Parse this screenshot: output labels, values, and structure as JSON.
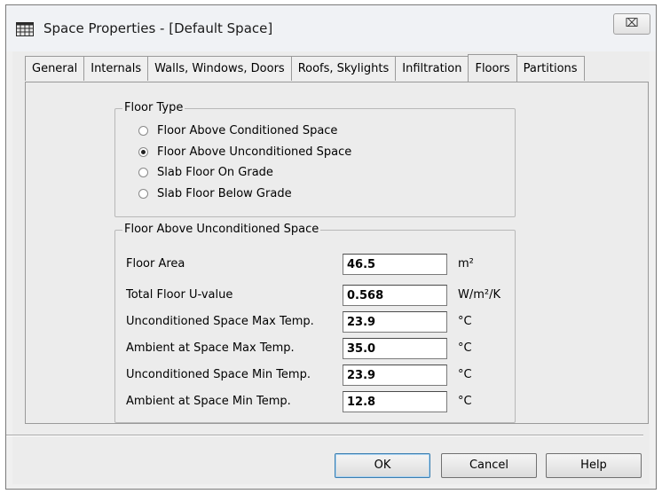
{
  "window": {
    "title": "Space Properties - [Default Space]",
    "app_icon": "spreadsheet-icon",
    "close_symbol": "⌧"
  },
  "tabs": [
    {
      "label": "General",
      "active": false
    },
    {
      "label": "Internals",
      "active": false
    },
    {
      "label": "Walls, Windows, Doors",
      "active": false
    },
    {
      "label": "Roofs, Skylights",
      "active": false
    },
    {
      "label": "Infiltration",
      "active": false
    },
    {
      "label": "Floors",
      "active": true
    },
    {
      "label": "Partitions",
      "active": false
    }
  ],
  "floor_type": {
    "title": "Floor Type",
    "options": [
      {
        "label": "Floor Above Conditioned Space",
        "checked": false
      },
      {
        "label": "Floor Above Unconditioned Space",
        "checked": true
      },
      {
        "label": "Slab Floor On Grade",
        "checked": false
      },
      {
        "label": "Slab Floor Below Grade",
        "checked": false
      }
    ]
  },
  "details": {
    "title": "Floor Above Unconditioned Space",
    "fields": [
      {
        "label": "Floor Area",
        "value": "46.5",
        "unit": "m²"
      },
      {
        "label": "Total Floor U-value",
        "value": "0.568",
        "unit": "W/m²/K"
      },
      {
        "label": "Unconditioned Space Max Temp.",
        "value": "23.9",
        "unit": "°C"
      },
      {
        "label": "Ambient at Space Max Temp.",
        "value": "35.0",
        "unit": "°C"
      },
      {
        "label": "Unconditioned Space Min Temp.",
        "value": "23.9",
        "unit": "°C"
      },
      {
        "label": "Ambient at Space Min Temp.",
        "value": "12.8",
        "unit": "°C"
      }
    ]
  },
  "buttons": {
    "ok": "OK",
    "cancel": "Cancel",
    "help": "Help"
  }
}
